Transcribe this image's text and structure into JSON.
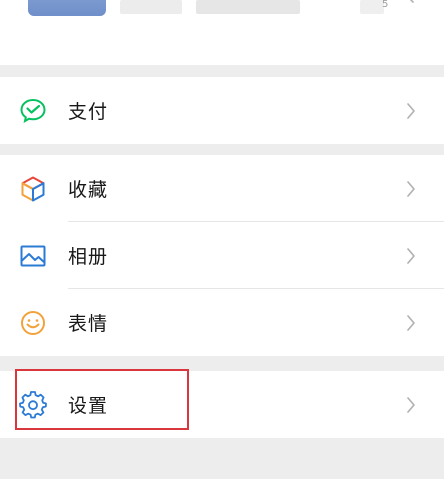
{
  "profile": {
    "small_text": "5"
  },
  "menu": {
    "pay": {
      "label": "支付",
      "icon": "wechat-pay-icon",
      "color": "#07c160"
    },
    "favorites": {
      "label": "收藏",
      "icon": "favorites-cube-icon"
    },
    "album": {
      "label": "相册",
      "icon": "album-image-icon",
      "color": "#2b7bd6"
    },
    "stickers": {
      "label": "表情",
      "icon": "sticker-smile-icon",
      "color": "#f2a23a"
    },
    "settings": {
      "label": "设置",
      "icon": "settings-gear-icon",
      "color": "#2b7bd6"
    }
  },
  "highlight": {
    "target": "settings",
    "color": "#d9363e"
  }
}
